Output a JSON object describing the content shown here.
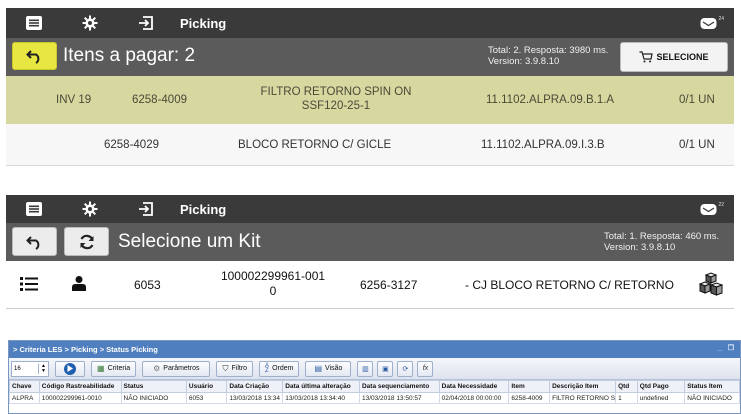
{
  "panel1": {
    "topbar": {
      "title": "Picking",
      "mail_badge": "24"
    },
    "subbar": {
      "title": "Itens a pagar: 2",
      "info_line1": "Total: 2. Resposta: 3980 ms.",
      "info_line2": "Version: 3.9.8.10",
      "select_label": "SELECIONE"
    },
    "rows": [
      {
        "inv": "INV 19",
        "code": "6258-4009",
        "desc_line1": "FILTRO RETORNO SPIN ON",
        "desc_line2": "SSF120-25-1",
        "location": "11.1102.ALPRA.09.B.1.A",
        "qty": "0/1 UN"
      },
      {
        "inv": "",
        "code": "6258-4029",
        "desc_line1": "BLOCO RETORNO C/ GICLE",
        "desc_line2": "",
        "location": "11.1102.ALPRA.09.I.3.B",
        "qty": "0/1 UN"
      }
    ]
  },
  "panel2": {
    "topbar": {
      "title": "Picking",
      "mail_badge": "22"
    },
    "subbar": {
      "title": "Selecione um Kit",
      "info_line1": "Total: 1. Resposta: 460 ms.",
      "info_line2": "Version: 3.9.8.10"
    },
    "row": {
      "num": "6053",
      "tracking_line1": "100002299961-001",
      "tracking_line2": "0",
      "code": "6256-3127",
      "desc": "- CJ BLOCO RETORNO C/ RETORNO"
    }
  },
  "panel3": {
    "breadcrumb": "> Criteria LES > Picking > Status Picking",
    "window_controls": "_ ❐",
    "spinner_value": "16",
    "toolbar": {
      "criteria": "Criteria",
      "parametros": "Parâmetros",
      "filtro": "Filtro",
      "ordem": "Ordem",
      "visao": "Visão"
    },
    "columns": [
      "Chave",
      "Código Rastreabilidade",
      "Status",
      "Usuário",
      "Data Criação",
      "Data última alteração",
      "Data sequenciamento",
      "Data Necessidade",
      "Item",
      "Descrição Item",
      "Qtd",
      "Qtd Pago",
      "Status Item"
    ],
    "rows": [
      [
        "ALPRA",
        "100002299961-0010",
        "NÃO INICIADO",
        "6053",
        "13/03/2018 13:34",
        "13/03/2018 13:34:40",
        "13/03/2018 13:50:57",
        "02/04/2018 00:00:00",
        "6258-4009",
        "FILTRO RETORNO S",
        "1",
        "undefined",
        "NÃO INICIADO"
      ]
    ]
  },
  "colors": {
    "topbar": "#3a3a3a",
    "subbar": "#5b5b5b",
    "highlight_row": "#d6d8a0",
    "back_button": "#e8e640",
    "window_title": "#4f7fbf"
  }
}
